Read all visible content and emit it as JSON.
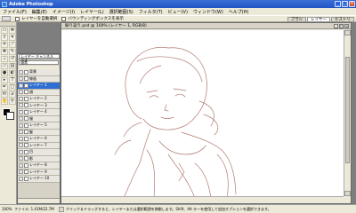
{
  "window": {
    "title": "Adobe Photoshop"
  },
  "menu": [
    "ファイル(F)",
    "編集(E)",
    "イメージ(I)",
    "レイヤー(L)",
    "選択範囲(S)",
    "フィルタ(T)",
    "ビュー(V)",
    "ウィンドウ(W)",
    "ヘルプ(H)"
  ],
  "options": {
    "check1": "レイヤーを自動選択",
    "check2": "バウンディングボックスを表示",
    "tabs": [
      "ブラシ",
      "レイヤー",
      "ヒストリ"
    ]
  },
  "layers_panel": {
    "tab": "レイヤー チャンネル パス",
    "blend_mode": "通常",
    "layers": [
      {
        "name": "背景"
      },
      {
        "name": "線画"
      },
      {
        "name": "レイヤー 1"
      },
      {
        "name": "顔"
      },
      {
        "name": "レイヤー 2"
      },
      {
        "name": "レイヤー 3"
      },
      {
        "name": "レイヤー 4"
      },
      {
        "name": "服"
      },
      {
        "name": "レイヤー 5"
      },
      {
        "name": "髪"
      },
      {
        "name": "レイヤー 6"
      },
      {
        "name": "レイヤー 7"
      },
      {
        "name": "目"
      },
      {
        "name": "影"
      },
      {
        "name": "レイヤー 8"
      },
      {
        "name": "レイヤー 9"
      },
      {
        "name": "レイヤー 10"
      }
    ]
  },
  "document": {
    "title": "振り返り.psd @ 100% (レイヤー 1, RGB/8)"
  },
  "status": {
    "zoom": "100%",
    "doc": "ファイル: 1.41M/22.7M",
    "hint": "クリック＆ドラッグすると、レイヤーまたは選択範囲を移動します。Shift、Alt キーを使用して追加オプションを選択できます。"
  }
}
